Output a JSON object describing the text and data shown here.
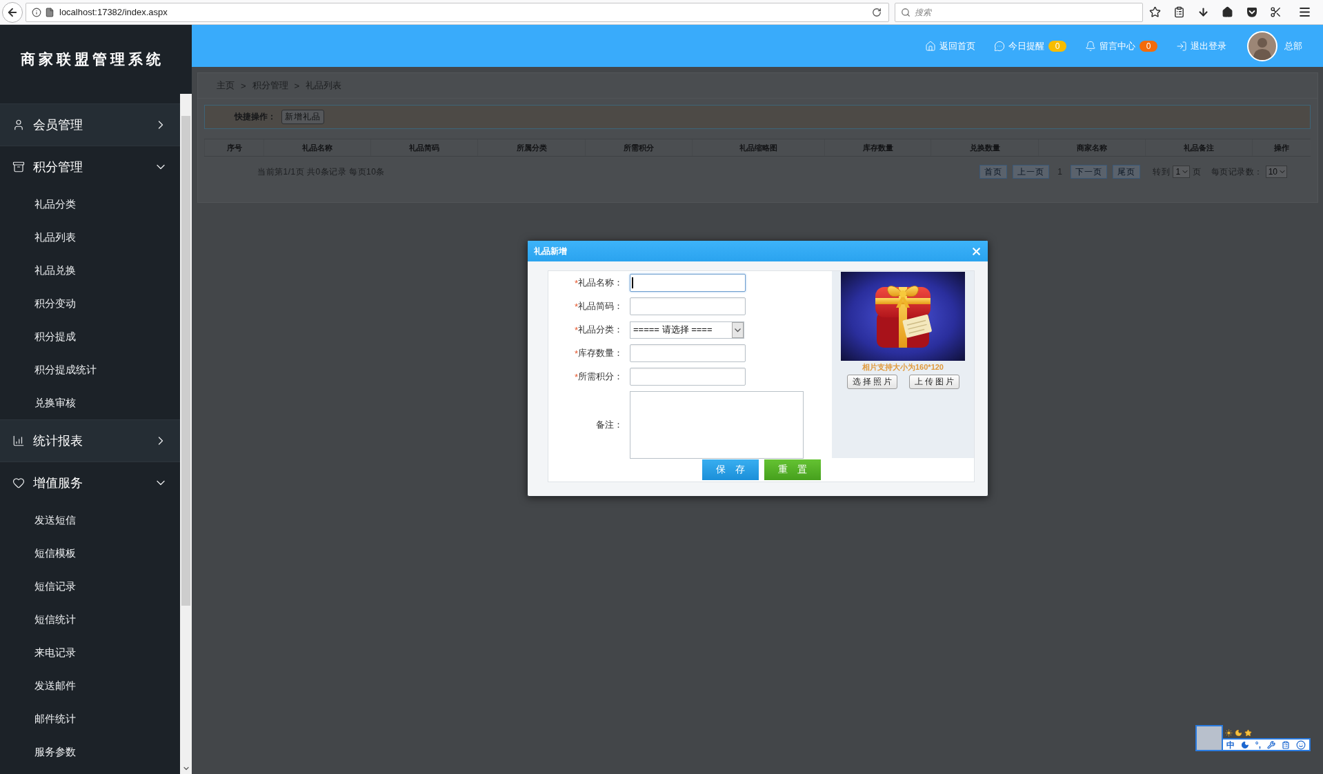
{
  "browser": {
    "url": "localhost:17382/index.aspx",
    "search_placeholder": "搜索"
  },
  "sidebar": {
    "logo": "商家联盟管理系统",
    "groups": [
      {
        "label": "会员管理",
        "expanded": false
      },
      {
        "label": "积分管理",
        "expanded": true,
        "children": [
          {
            "label": "礼品分类"
          },
          {
            "label": "礼品列表"
          },
          {
            "label": "礼品兑换"
          },
          {
            "label": "积分变动"
          },
          {
            "label": "积分提成"
          },
          {
            "label": "积分提成统计"
          },
          {
            "label": "兑换审核"
          }
        ]
      },
      {
        "label": "统计报表",
        "expanded": false
      },
      {
        "label": "增值服务",
        "expanded": true,
        "children": [
          {
            "label": "发送短信"
          },
          {
            "label": "短信模板"
          },
          {
            "label": "短信记录"
          },
          {
            "label": "短信统计"
          },
          {
            "label": "来电记录"
          },
          {
            "label": "发送邮件"
          },
          {
            "label": "邮件统计"
          },
          {
            "label": "服务参数"
          }
        ]
      }
    ]
  },
  "header": {
    "nav": [
      {
        "label": "返回首页"
      },
      {
        "label": "今日提醒",
        "badge": "0",
        "color": "#f7bd00"
      },
      {
        "label": "留言中心",
        "badge": "0",
        "color": "#f36b0a"
      },
      {
        "label": "退出登录"
      }
    ],
    "user": {
      "name": "总部"
    }
  },
  "content": {
    "breadcrumb": {
      "items": [
        "主页",
        "积分管理",
        "礼品列表"
      ],
      "separator": ">"
    },
    "quick_actions": {
      "label": "快捷操作：",
      "buttons": [
        "新增礼品"
      ]
    },
    "table": {
      "columns": [
        "序号",
        "礼品名称",
        "礼品简码",
        "所属分类",
        "所需积分",
        "礼品缩略图",
        "库存数量",
        "兑换数量",
        "商家名称",
        "礼品备注",
        "操作"
      ]
    },
    "pager": {
      "summary": "当前第1/1页 共0条记录 每页10条",
      "links": [
        {
          "label": "首页",
          "kind": "link"
        },
        {
          "label": "上一页",
          "kind": "link"
        },
        {
          "label": "1",
          "kind": "current"
        },
        {
          "label": "下一页",
          "kind": "link"
        },
        {
          "label": "尾页",
          "kind": "link"
        }
      ],
      "goto": {
        "label": "转到",
        "value": "1",
        "suffix": "页"
      },
      "page_size": {
        "label": "每页记录数：",
        "value": "10"
      }
    }
  },
  "dialog": {
    "title": "礼品新增",
    "required_mark": "*",
    "fields": [
      {
        "label": "礼品名称：",
        "kind": "text",
        "required": true,
        "focused": true
      },
      {
        "label": "礼品简码：",
        "kind": "text",
        "required": true,
        "focused": false
      },
      {
        "label": "礼品分类：",
        "kind": "select",
        "required": true,
        "focused": false,
        "value": "===== 请选择 ===="
      },
      {
        "label": "库存数量：",
        "kind": "text",
        "required": true,
        "focused": false
      },
      {
        "label": "所需积分：",
        "kind": "text",
        "required": true,
        "focused": false
      },
      {
        "label": "备注：",
        "kind": "textarea",
        "required": false,
        "focused": false
      }
    ],
    "photo": {
      "caption": "相片支持大小为160*120",
      "buttons": [
        "选择照片",
        "上传图片"
      ]
    },
    "buttons": [
      {
        "label": "保存",
        "kind": "primary"
      },
      {
        "label": "重置",
        "kind": "success"
      }
    ]
  },
  "ime_toolbar": {
    "mode": "中",
    "punctuation": "°,"
  }
}
